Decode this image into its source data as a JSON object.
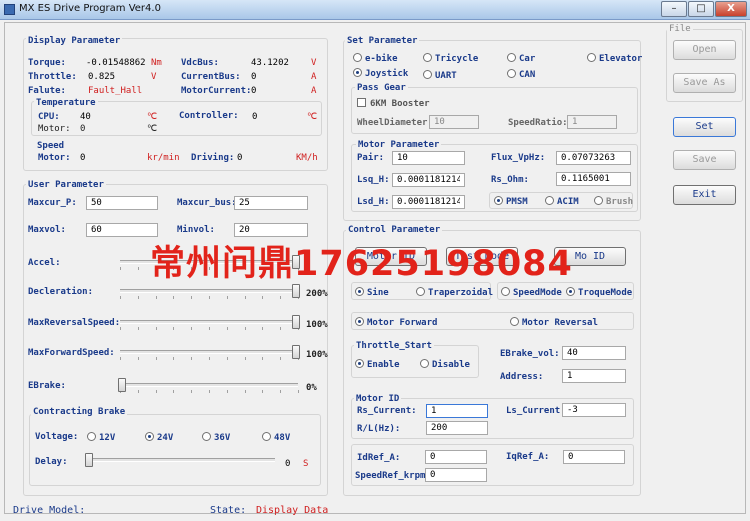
{
  "window": {
    "title": "MX ES Drive Program Ver4.0",
    "minimize": "–",
    "maximize": "□",
    "close": "X"
  },
  "display": {
    "title": "Display Parameter",
    "torque": {
      "label": "Torque:",
      "value": "-0.01548862",
      "unit": "Nm"
    },
    "throttle": {
      "label": "Throttle:",
      "value": "0.825",
      "unit": "V"
    },
    "falute": {
      "label": "Falute:",
      "value": "Fault_Hall"
    },
    "vdcbus": {
      "label": "VdcBus:",
      "value": "43.1202",
      "unit": "V"
    },
    "currentbus": {
      "label": "CurrentBus:",
      "value": "0",
      "unit": "A"
    },
    "motorcurrent": {
      "label": "MotorCurrent:",
      "value": "0",
      "unit": "A"
    },
    "temperature": {
      "title": "Temperature",
      "cpu_label": "CPU:",
      "cpu_value": "40",
      "cpu_unit": "℃",
      "controller_label": "Controller:",
      "controller_value": "0",
      "controller_unit": "℃",
      "motor_label": "Motor:",
      "motor_value": "0",
      "motor_unit": "℃"
    },
    "speed": {
      "title": "Speed",
      "motor_label": "Motor:",
      "motor_value": "0",
      "motor_unit": "kr/min",
      "driving_label": "Driving:",
      "driving_value": "0",
      "driving_unit": "KM/h"
    }
  },
  "user": {
    "title": "User Parameter",
    "maxcur_p": {
      "label": "Maxcur_P:",
      "value": "50"
    },
    "maxcur_bus": {
      "label": "Maxcur_bus:",
      "value": "25"
    },
    "maxvol": {
      "label": "Maxvol:",
      "value": "60"
    },
    "minvol": {
      "label": "Minvol:",
      "value": "20"
    },
    "sliders": [
      {
        "label": "Accel:",
        "readout": "",
        "level": 1.0
      },
      {
        "label": "Decleration:",
        "readout": "200%",
        "level": 1.0
      },
      {
        "label": "MaxReversalSpeed:",
        "readout": "100%",
        "level": 1.0
      },
      {
        "label": "MaxForwardSpeed:",
        "readout": "100%",
        "level": 1.0
      },
      {
        "label": "EBrake:",
        "readout": "0%",
        "level": 0.0
      }
    ],
    "contracting": {
      "title": "Contracting Brake",
      "voltage_label": "Voltage:",
      "voltage_options": [
        "12V",
        "24V",
        "36V",
        "48V"
      ],
      "voltage_selected": "24V",
      "delay_label": "Delay:",
      "delay_value": "0",
      "delay_unit": "S",
      "delay_level": 0.0
    }
  },
  "set": {
    "title": "Set Parameter",
    "vehicle_options": [
      "e-bike",
      "Tricycle",
      "Car",
      "Elevator",
      "Joystick",
      "UART",
      "CAN"
    ],
    "vehicle_selected": "Joystick",
    "pass_gear": {
      "title": "Pass Gear",
      "booster_label": "6KM Booster",
      "booster_checked": false,
      "wheel_label": "WheelDiameter:",
      "wheel_value": "10",
      "ratio_label": "SpeedRatio:",
      "ratio_value": "1"
    },
    "motor": {
      "title": "Motor Parameter",
      "pair_label": "Pair:",
      "pair_value": "10",
      "flux_label": "Flux_VpHz:",
      "flux_value": "0.07073263",
      "lsq_label": "Lsq_H:",
      "lsq_value": "0.0001181214",
      "rs_label": "Rs_Ohm:",
      "rs_value": "0.1165001",
      "lsd_label": "Lsd_H:",
      "lsd_value": "0.0001181214",
      "type_options": [
        "PMSM",
        "ACIM",
        "Brush"
      ],
      "type_selected": "PMSM"
    }
  },
  "control": {
    "title": "Control Parameter",
    "buttons": [
      "Motor ID",
      "Test Mode",
      "Mo ID"
    ],
    "wave_options": [
      "Sine",
      "Traperzoidal"
    ],
    "wave_selected": "Sine",
    "mode_options": [
      "SpeedMode",
      "TroqueMode"
    ],
    "mode_selected": "TroqueMode",
    "direction_options": [
      "Motor Forward",
      "Motor Reversal"
    ],
    "direction_selected": "Motor Forward",
    "throttle_start": {
      "title": "Throttle_Start",
      "options": [
        "Enable",
        "Disable"
      ],
      "selected": "Enable"
    },
    "ebrake_vol": {
      "label": "EBrake_vol:",
      "value": "40"
    },
    "address": {
      "label": "Address:",
      "value": "1"
    },
    "motor_id": {
      "title": "Motor ID",
      "rs_current_label": "Rs_Current:",
      "rs_current_value": "1",
      "ls_current_label": "Ls_Current:",
      "ls_current_value": "-3",
      "rl_label": "R/L(Hz):",
      "rl_value": "200"
    },
    "idref": {
      "label": "IdRef_A:",
      "value": "0"
    },
    "iqref": {
      "label": "IqRef_A:",
      "value": "0"
    },
    "speedref": {
      "label": "SpeedRef_krpm:",
      "value": "0"
    }
  },
  "file": {
    "title": "File",
    "open": "Open",
    "save_as": "Save As"
  },
  "actions": {
    "set": "Set",
    "save": "Save",
    "exit": "Exit"
  },
  "status": {
    "drive_model_label": "Drive Model:",
    "drive_model_value": "",
    "state_label": "State:",
    "state_value": "Display Data"
  },
  "watermark": "常州问鼎17625198084",
  "colors": {
    "label": "#1a3a8a",
    "unit": "#d02020",
    "watermark": "#e2231a"
  }
}
